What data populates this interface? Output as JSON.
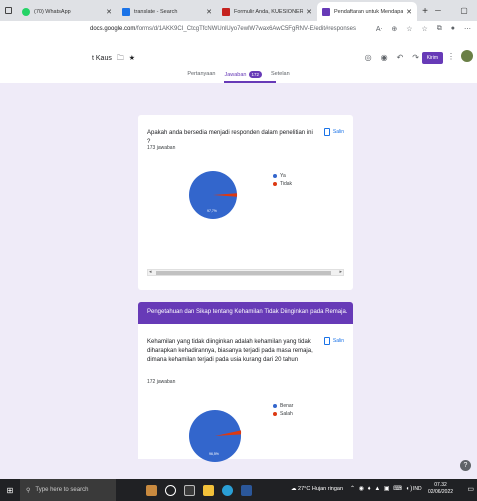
{
  "browser": {
    "tabs": [
      {
        "label": "(70) WhatsApp",
        "favicon_color": "#25d366"
      },
      {
        "label": "translate - Search",
        "favicon_color": "#1a73e8"
      },
      {
        "label": "Formulir Anda, KUESIONER GAN",
        "favicon_color": "#c5221f"
      },
      {
        "label": "Pendaftaran untuk Mendapat Ku",
        "favicon_color": "#673ab7"
      }
    ],
    "url_domain": "docs.google.com",
    "url_path": "/forms/d/1AKK9CI_CtcgTfcNWUnlUyo7ewlW7wax6AwC5FgRNV-E/edit#responses"
  },
  "form": {
    "title": "t Kaus",
    "send_label": "Kirim",
    "tabs": {
      "questions": "Pertanyaan",
      "responses": "Jawaban",
      "responses_count": "172",
      "settings": "Setelan"
    }
  },
  "questions": [
    {
      "text": "Apakah anda bersedia menjadi responden dalam penelitian ini ?",
      "count": "173 jawaban",
      "copy_label": "Salin",
      "pie_label": "97,7%",
      "legend": [
        "Ya",
        "Tidak"
      ]
    },
    {
      "section": "Pengetahuan dan Sikap tentang Kehamilan Tidak Diinginkan pada Remaja.",
      "text": "Kehamilan yang tidak diinginkan adalah kehamilan yang tidak diharapkan kehadirannya, biasanya terjadi pada masa remaja, dimana kehamilan terjadi pada usia kurang dari 20 tahun",
      "count": "172 jawaban",
      "copy_label": "Salin",
      "pie_label": "96,5%",
      "legend": [
        "Benar",
        "Salah"
      ]
    }
  ],
  "colors": {
    "blue": "#3366cc",
    "red": "#dc3912",
    "purple": "#673ab7"
  },
  "taskbar": {
    "search_placeholder": "Type here to search",
    "weather": "27°C  Hujan ringan",
    "lang": "IND",
    "time": "07.32",
    "date": "02/06/2022"
  }
}
